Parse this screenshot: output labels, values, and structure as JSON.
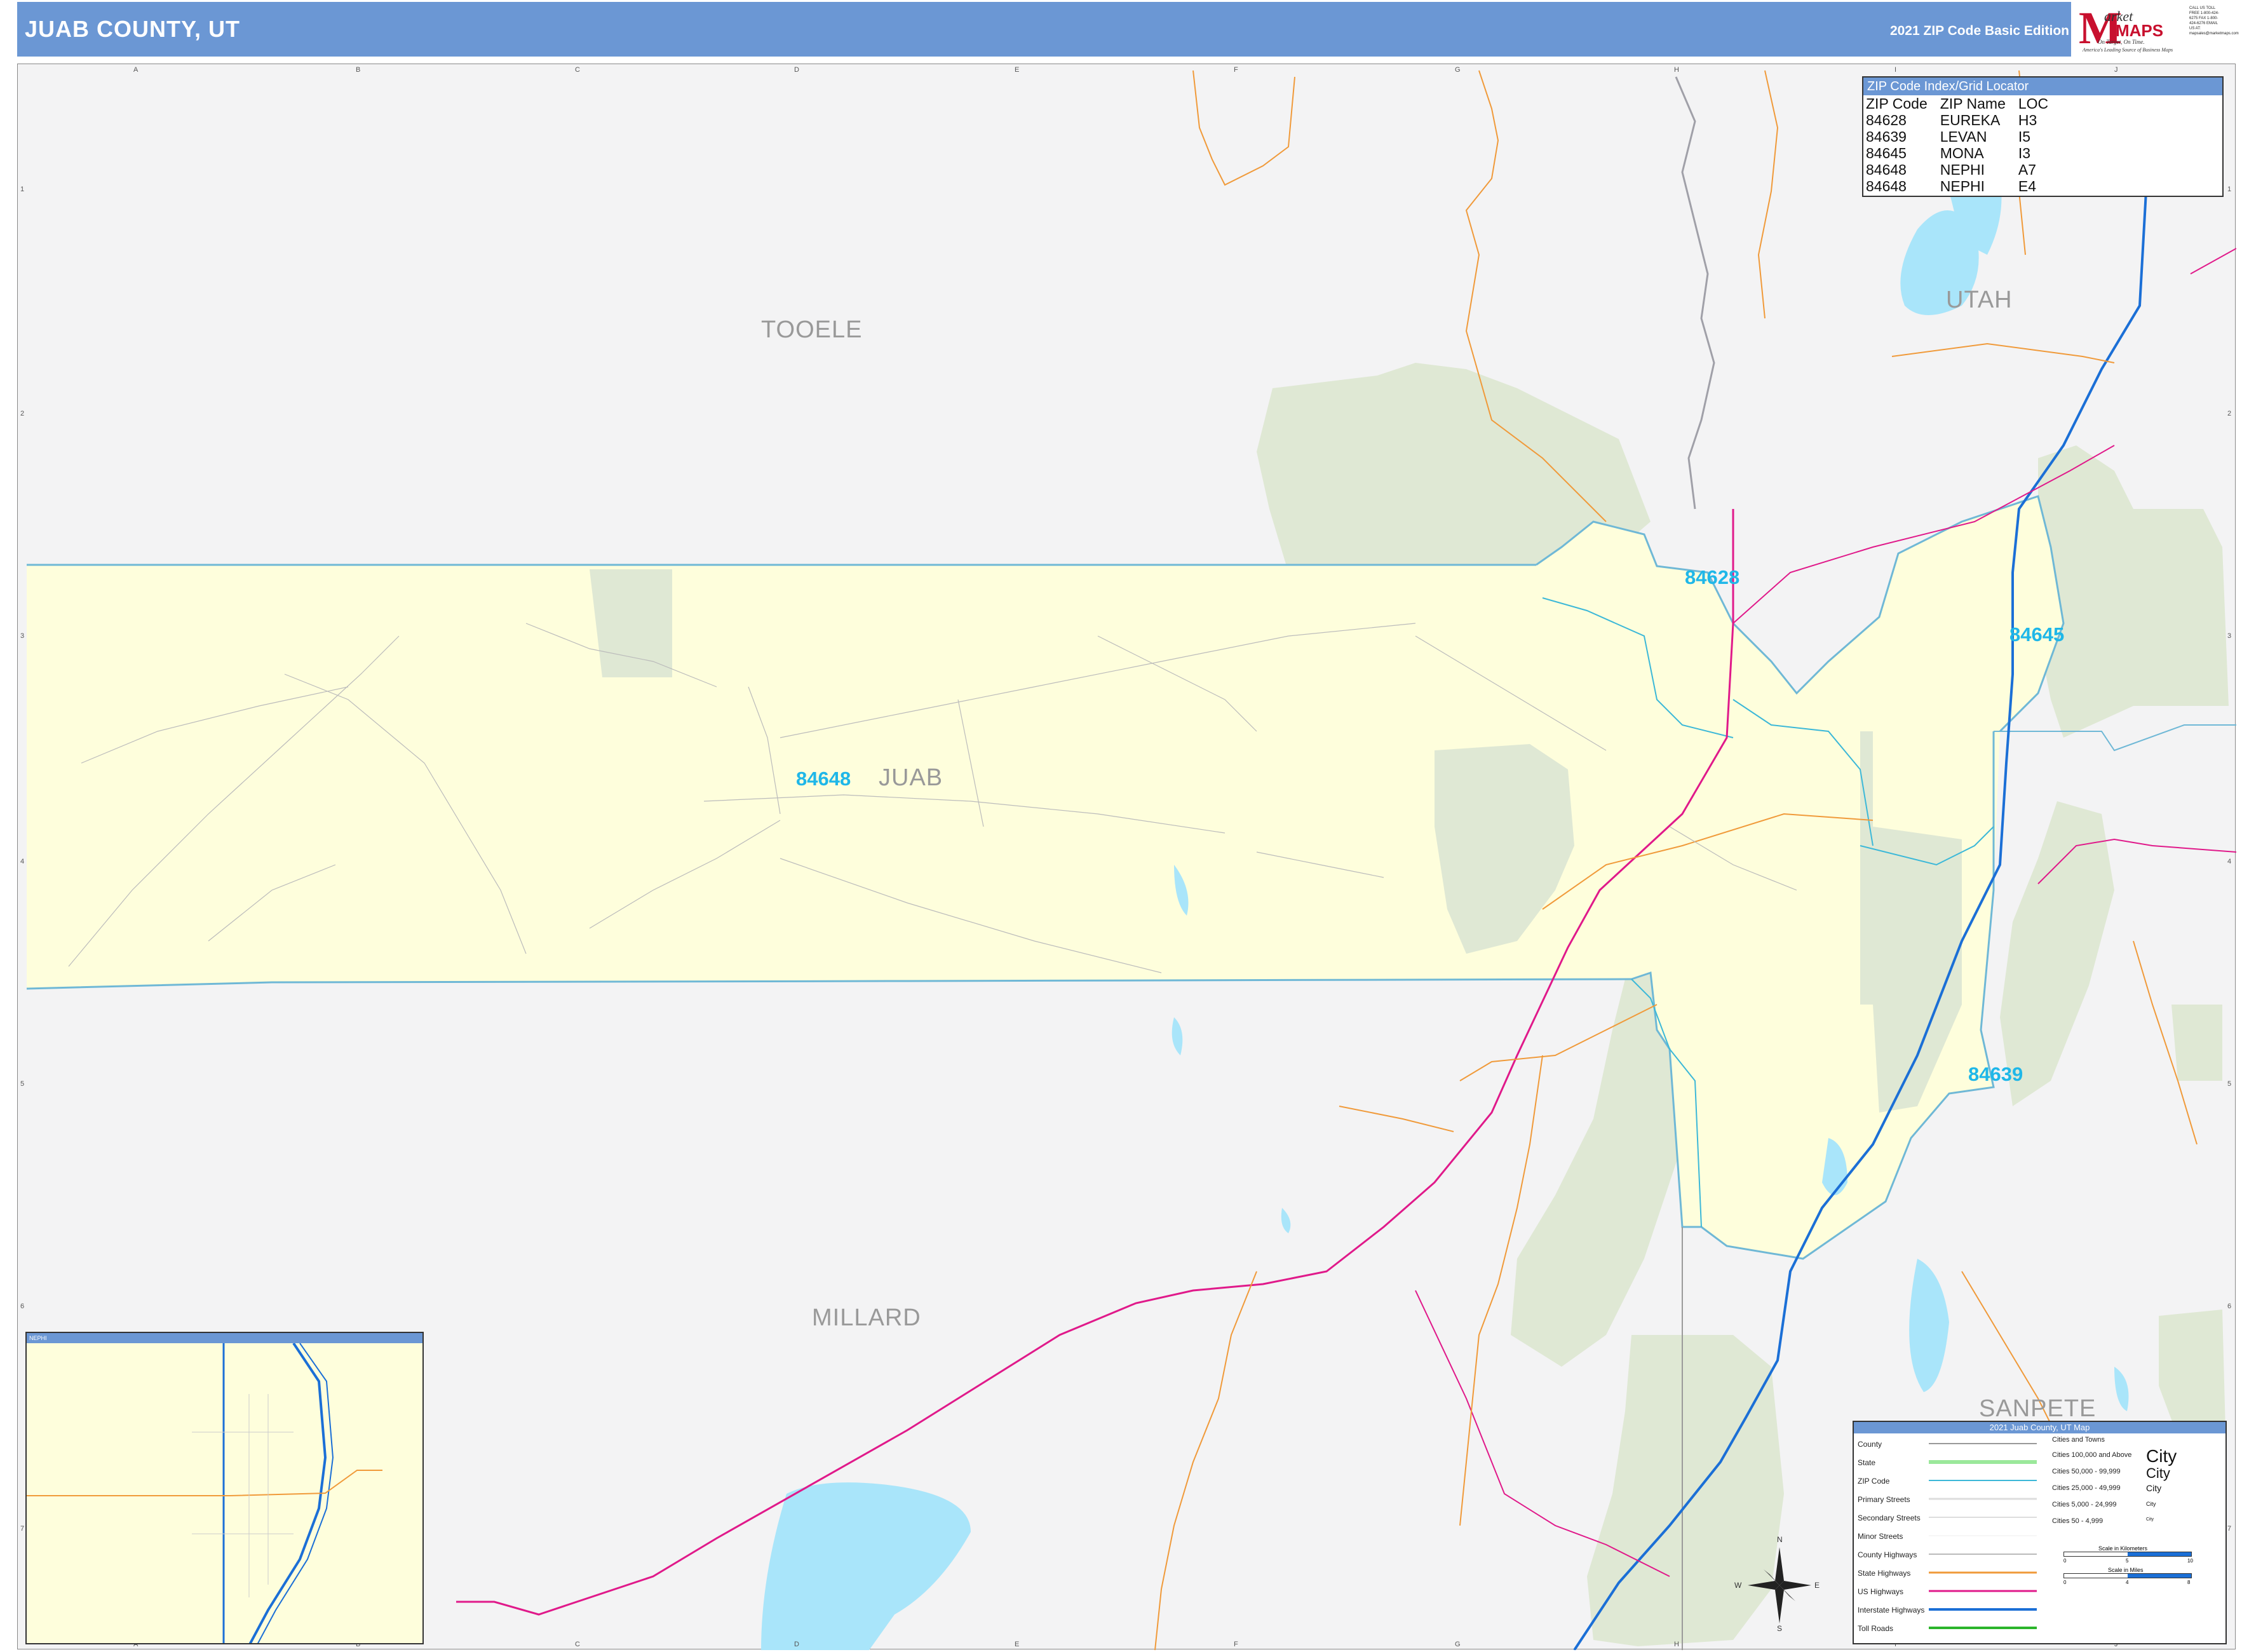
{
  "header": {
    "title": "JUAB COUNTY, UT",
    "edition": "2021 ZIP Code Basic Edition"
  },
  "logo": {
    "m": "M",
    "brand1": "arket",
    "brand2": "MAPS",
    "tagline": "On Target, On Time.",
    "tagline2": "America's Leading Source of Business Maps",
    "contact": "CALL US TOLL FREE 1-800-424-6275 FAX 1-800-424-6276 EMAIL US AT: mapsales@marketmaps.com"
  },
  "grid": {
    "letters": [
      "A",
      "B",
      "C",
      "D",
      "E",
      "F",
      "G",
      "H",
      "I",
      "J"
    ],
    "numbers": [
      "1",
      "2",
      "3",
      "4",
      "5",
      "6",
      "7"
    ]
  },
  "counties": {
    "tooele": "TOOELE",
    "utah": "UTAH",
    "juab": "JUAB",
    "millard": "MILLARD",
    "sanpete": "SANPETE"
  },
  "zips": {
    "z84628": "84628",
    "z84645": "84645",
    "z84648": "84648",
    "z84639": "84639"
  },
  "zip_index": {
    "title": "ZIP Code Index/Grid Locator",
    "columns": [
      "ZIP Code",
      "ZIP Name",
      "LOC"
    ],
    "rows": [
      [
        "84628",
        "EUREKA",
        "H3"
      ],
      [
        "84639",
        "LEVAN",
        "I5"
      ],
      [
        "84645",
        "MONA",
        "I3"
      ],
      [
        "84648",
        "NEPHI",
        "A7"
      ],
      [
        "84648",
        "NEPHI",
        "E4"
      ]
    ]
  },
  "inset": {
    "title": "NEPHI"
  },
  "legend": {
    "title": "2021 Juab County, UT Map",
    "items": [
      "County",
      "State",
      "ZIP Code",
      "Primary Streets",
      "Secondary Streets",
      "Minor Streets",
      "County Highways",
      "State Highways",
      "US Highways",
      "Interstate Highways",
      "Toll Roads"
    ],
    "cities_title": "Cities and Towns",
    "city_tiers": [
      {
        "label": "Cities 100,000 and Above",
        "sample": "City"
      },
      {
        "label": "Cities 50,000 - 99,999",
        "sample": "City"
      },
      {
        "label": "Cities 25,000 - 49,999",
        "sample": "City"
      },
      {
        "label": "Cities 5,000 - 24,999",
        "sample": "City"
      },
      {
        "label": "Cities 50 - 4,999",
        "sample": "City"
      }
    ],
    "scale_km": "Scale in Kilometers",
    "scale_mi": "Scale in Miles",
    "km_ticks": [
      "0",
      "5",
      "10"
    ],
    "mi_ticks": [
      "0",
      "4",
      "8"
    ]
  },
  "compass": {
    "n": "N",
    "s": "S",
    "e": "E",
    "w": "W"
  },
  "colors": {
    "header": "#6b97d4",
    "juab_fill": "#fefedc",
    "outside_fill": "#f3f3f4",
    "forest": "#dfe8d4",
    "water": "#a9e5fa",
    "zip_boundary": "#3cb8d8",
    "county_boundary": "#6fb8d6",
    "us_highway": "#e0198a",
    "interstate": "#1b6fd6",
    "state_highway": "#f09a3a",
    "zip_label": "#1fb7e8",
    "county_label": "#999999"
  }
}
